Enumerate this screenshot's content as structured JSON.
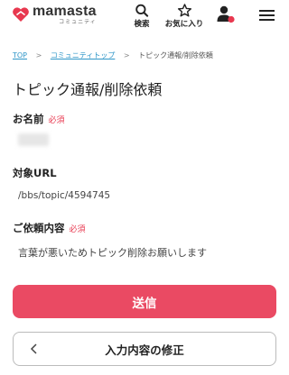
{
  "header": {
    "logo_word": "mamasta",
    "logo_sub": "コミュニティ",
    "search_label": "検索",
    "favorites_label": "お気に入り",
    "user_icon": "user-icon",
    "menu_icon": "hamburger-menu-icon",
    "brand_color": "#e8384f"
  },
  "breadcrumb": {
    "items": [
      "TOP",
      "コミュニティトップ",
      "トピック通報/削除依頼"
    ],
    "separator": ">"
  },
  "page": {
    "title": "トピック通報/削除依頼"
  },
  "form": {
    "name_label": "お名前",
    "name_required": "必須",
    "url_label": "対象URL",
    "url_value": "/bbs/topic/4594745",
    "request_label": "ご依頼内容",
    "request_required": "必須",
    "request_value": "言葉が悪いためトピック削除お願いします"
  },
  "actions": {
    "submit_label": "送信",
    "submit_color": "#ea4a63",
    "back_label": "入力内容の修正"
  }
}
